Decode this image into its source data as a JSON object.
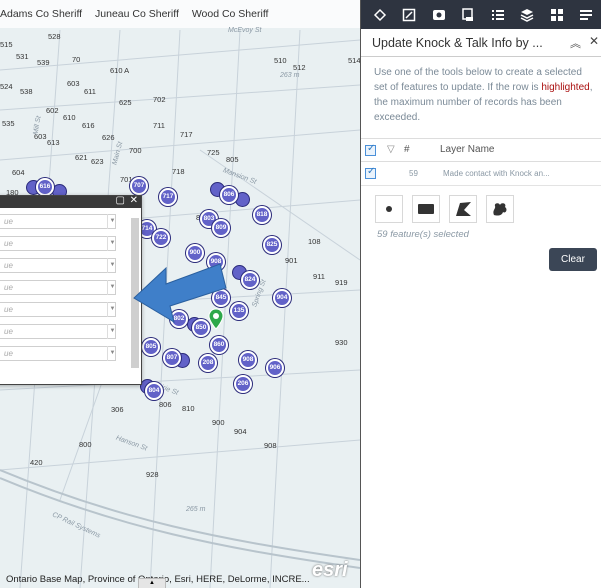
{
  "bookmarks": [
    "Adams Co Sheriff",
    "Juneau Co Sheriff",
    "Wood Co Sheriff"
  ],
  "map": {
    "parcel_labels": [
      "528",
      "515",
      "531",
      "539",
      "70",
      "610 A",
      "524",
      "538",
      "603",
      "611",
      "625",
      "702",
      "535",
      "602",
      "610",
      "616",
      "711",
      "717",
      "603",
      "613",
      "626",
      "700",
      "621",
      "623",
      "725",
      "805",
      "604",
      "718",
      "701",
      "180",
      "803",
      "818",
      "108",
      "901",
      "911",
      "919",
      "824",
      "930",
      "900",
      "904",
      "908",
      "306",
      "806",
      "810",
      "800",
      "420",
      "928",
      "510",
      "512",
      "514"
    ],
    "marker_labels": [
      "616",
      "707",
      "806",
      "717",
      "803",
      "809",
      "714",
      "722",
      "818",
      "900",
      "908",
      "825",
      "824",
      "845",
      "904",
      "802",
      "850",
      "135",
      "805",
      "860",
      "807",
      "208",
      "908",
      "906",
      "206",
      "804"
    ],
    "street_labels": [
      "McEvoy St",
      "Mansion St",
      "Spring St",
      "Main St",
      "Prairie St",
      "Hanson St",
      "CP Rail Systems",
      "Mill St"
    ],
    "elevations": [
      "263 m",
      "265 m"
    ],
    "attribution": "Ontario Base Map, Province of Ontario, Esri, HERE, DeLorme, INCRE...",
    "logo": "esri"
  },
  "attr_popup": {
    "fields": [
      "ue",
      "ue",
      "ue",
      "ue",
      "ue",
      "ue",
      "ue",
      "ue"
    ]
  },
  "panel": {
    "title": "Update Knock & Talk Info by ...",
    "intro_before": "Use one of the tools below to create a selected set of features to update. If the row is ",
    "intro_highlight": "highlighted",
    "intro_after": ", the maximum number of records has been exceeded.",
    "table": {
      "col_num": "#",
      "col_name": "Layer Name",
      "rows": [
        {
          "count": "59",
          "name": "Made contact with Knock an..."
        }
      ]
    },
    "selected_text": "59 feature(s) selected",
    "clear_label": "Clear"
  },
  "colors": {
    "toolbar": "#2e3440",
    "marker": "#6262c8",
    "arrow": "#3f7fc9",
    "highlight": "#a11111",
    "clear_button": "#3b4656"
  }
}
